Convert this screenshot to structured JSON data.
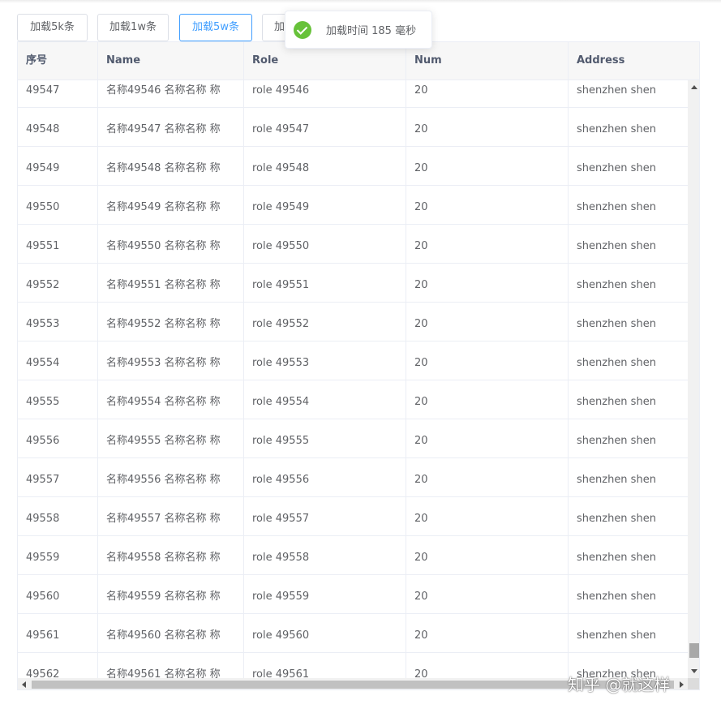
{
  "toolbar": {
    "buttons": [
      {
        "label": "加载5k条",
        "active": false
      },
      {
        "label": "加载1w条",
        "active": false
      },
      {
        "label": "加载5w条",
        "active": true
      },
      {
        "label": "加",
        "active": false
      }
    ]
  },
  "toast": {
    "icon": "check-circle-icon",
    "text": "加载时间 185 毫秒",
    "color": "#67c23a"
  },
  "table": {
    "columns": [
      "序号",
      "Name",
      "Role",
      "Num",
      "Address"
    ],
    "rows": [
      {
        "id": "49547",
        "name": "名称49546 名称名称 称",
        "role": "role 49546",
        "num": "20",
        "address": "shenzhen shen"
      },
      {
        "id": "49548",
        "name": "名称49547 名称名称 称",
        "role": "role 49547",
        "num": "20",
        "address": "shenzhen shen"
      },
      {
        "id": "49549",
        "name": "名称49548 名称名称 称",
        "role": "role 49548",
        "num": "20",
        "address": "shenzhen shen"
      },
      {
        "id": "49550",
        "name": "名称49549 名称名称 称",
        "role": "role 49549",
        "num": "20",
        "address": "shenzhen shen"
      },
      {
        "id": "49551",
        "name": "名称49550 名称名称 称",
        "role": "role 49550",
        "num": "20",
        "address": "shenzhen shen"
      },
      {
        "id": "49552",
        "name": "名称49551 名称名称 称",
        "role": "role 49551",
        "num": "20",
        "address": "shenzhen shen"
      },
      {
        "id": "49553",
        "name": "名称49552 名称名称 称",
        "role": "role 49552",
        "num": "20",
        "address": "shenzhen shen"
      },
      {
        "id": "49554",
        "name": "名称49553 名称名称 称",
        "role": "role 49553",
        "num": "20",
        "address": "shenzhen shen"
      },
      {
        "id": "49555",
        "name": "名称49554 名称名称 称",
        "role": "role 49554",
        "num": "20",
        "address": "shenzhen shen"
      },
      {
        "id": "49556",
        "name": "名称49555 名称名称 称",
        "role": "role 49555",
        "num": "20",
        "address": "shenzhen shen"
      },
      {
        "id": "49557",
        "name": "名称49556 名称名称 称",
        "role": "role 49556",
        "num": "20",
        "address": "shenzhen shen"
      },
      {
        "id": "49558",
        "name": "名称49557 名称名称 称",
        "role": "role 49557",
        "num": "20",
        "address": "shenzhen shen"
      },
      {
        "id": "49559",
        "name": "名称49558 名称名称 称",
        "role": "role 49558",
        "num": "20",
        "address": "shenzhen shen"
      },
      {
        "id": "49560",
        "name": "名称49559 名称名称 称",
        "role": "role 49559",
        "num": "20",
        "address": "shenzhen shen"
      },
      {
        "id": "49561",
        "name": "名称49560 名称名称 称",
        "role": "role 49560",
        "num": "20",
        "address": "shenzhen shen"
      },
      {
        "id": "49562",
        "name": "名称49561 名称名称 称",
        "role": "role 49561",
        "num": "20",
        "address": "shenzhen shen"
      }
    ]
  },
  "watermark": "知乎 @就这样"
}
